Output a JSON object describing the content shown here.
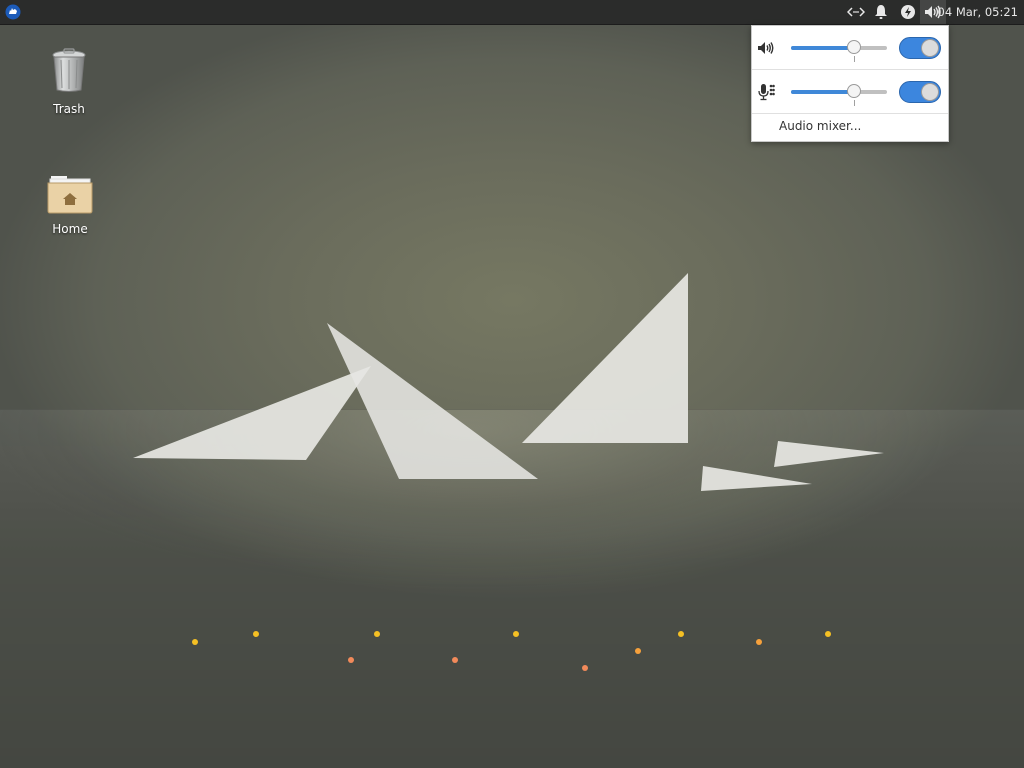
{
  "panel": {
    "menu_icon": "xfce-mouse-logo-icon",
    "tray_icons": [
      "network-icon",
      "notification-bell-icon",
      "power-manager-icon",
      "volume-icon"
    ],
    "clock": "04 Mar, 05:21"
  },
  "desktop": {
    "icons": [
      {
        "label": "Trash",
        "icon": "trash-icon"
      },
      {
        "label": "Home",
        "icon": "home-folder-icon"
      }
    ]
  },
  "audio_popup": {
    "output": {
      "icon": "speaker-icon",
      "volume_fraction": 0.66,
      "enabled": true
    },
    "input": {
      "icon": "microphone-icon",
      "volume_fraction": 0.66,
      "enabled": true
    },
    "mixer_label": "Audio mixer..."
  },
  "colors": {
    "accent": "#3c86de",
    "panel_bg": "#2b2c2b",
    "dot_yellow": "#f5c024",
    "dot_orange": "#f7a13c",
    "dot_salmon": "#f28a5a"
  }
}
